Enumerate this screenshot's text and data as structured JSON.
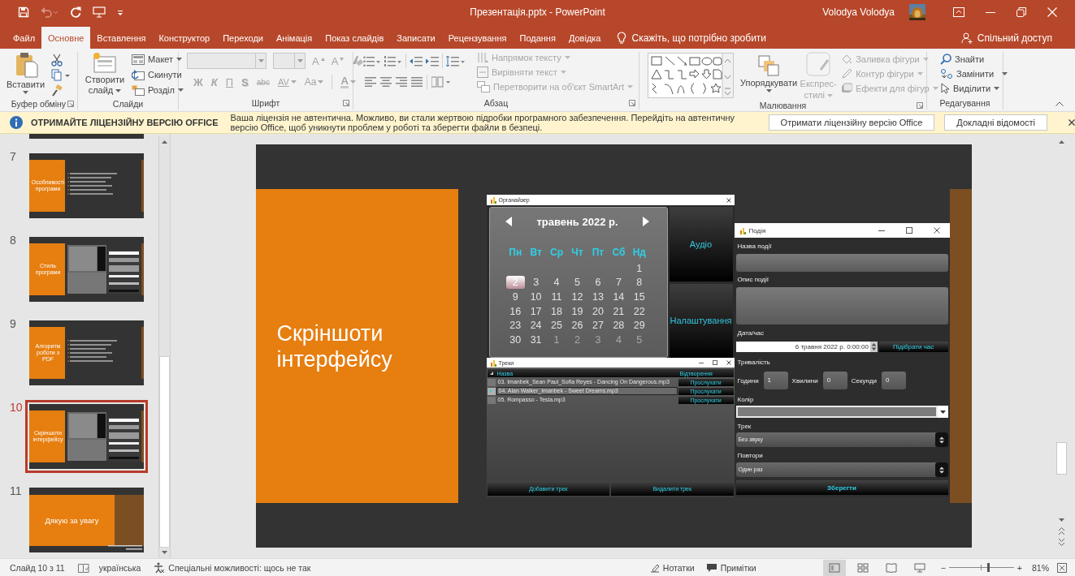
{
  "window": {
    "title": "Презентація.pptx - PowerPoint",
    "user": "Volodya Volodya"
  },
  "ribbon_tabs": [
    {
      "label": "Файл",
      "selected": false
    },
    {
      "label": "Основне",
      "selected": true
    },
    {
      "label": "Вставлення",
      "selected": false
    },
    {
      "label": "Конструктор",
      "selected": false
    },
    {
      "label": "Переходи",
      "selected": false
    },
    {
      "label": "Анімація",
      "selected": false
    },
    {
      "label": "Показ слайдів",
      "selected": false
    },
    {
      "label": "Записати",
      "selected": false
    },
    {
      "label": "Рецензування",
      "selected": false
    },
    {
      "label": "Подання",
      "selected": false
    },
    {
      "label": "Довідка",
      "selected": false
    }
  ],
  "tell_me": "Скажіть, що потрібно зробити",
  "share": "Спільний доступ",
  "ribbon_groups": [
    {
      "kind": "clipboard",
      "label": "Буфер обміну",
      "items": [
        {
          "label": "Вставити",
          "disabled": false
        }
      ]
    },
    {
      "kind": "slides",
      "label": "Слайди",
      "items": [
        {
          "label": "Створити слайд",
          "disabled": false
        },
        {
          "label": "Макет",
          "disabled": false
        },
        {
          "label": "Скинути",
          "disabled": false
        },
        {
          "label": "Розділ",
          "disabled": false
        }
      ]
    },
    {
      "kind": "font",
      "label": "Шрифт",
      "items": [
        {
          "label": "A",
          "disabled": true
        },
        {
          "label": "A",
          "disabled": true
        },
        {
          "label": "Ж",
          "disabled": true
        },
        {
          "label": "К",
          "disabled": true
        },
        {
          "label": "П",
          "disabled": true
        },
        {
          "label": "S",
          "disabled": true
        },
        {
          "label": "abc",
          "disabled": true
        },
        {
          "label": "AV",
          "disabled": true
        },
        {
          "label": "Aa",
          "disabled": true
        },
        {
          "label": "A",
          "disabled": true
        }
      ]
    },
    {
      "kind": "paragraph",
      "label": "Абзац",
      "items": [
        {
          "label": "Напрямок тексту",
          "disabled": true
        },
        {
          "label": "Вирівняти текст",
          "disabled": true
        },
        {
          "label": "Перетворити на об'єкт SmartArt",
          "disabled": true
        }
      ]
    },
    {
      "kind": "drawing",
      "label": "Малювання",
      "items": [
        {
          "label": "Упорядкувати",
          "disabled": false
        },
        {
          "label": "Експрес-стилі",
          "disabled": true
        },
        {
          "label": "Заливка фігури",
          "disabled": true
        },
        {
          "label": "Контур фігури",
          "disabled": true
        },
        {
          "label": "Ефекти для фігур",
          "disabled": true
        }
      ]
    },
    {
      "kind": "editing",
      "label": "Редагування",
      "items": [
        {
          "label": "Знайти",
          "disabled": false
        },
        {
          "label": "Замінити",
          "disabled": false
        },
        {
          "label": "Виділити",
          "disabled": false
        }
      ]
    }
  ],
  "license_bar": {
    "heading": "ОТРИМАЙТЕ ЛІЦЕНЗІЙНУ ВЕРСІЮ OFFICE",
    "message": "Ваша ліцензія не автентична. Можливо, ви стали жертвою підробки програмного забезпечення. Перейдіть на автентичну версію Office, щоб уникнути проблем у роботі та зберегти файли в безпеці.",
    "buttons": [
      "Отримати ліцензійну версію Office",
      "Докладні відомості"
    ]
  },
  "thumbnails": [
    {
      "number": "7",
      "title": "Особливості програми",
      "kind": "bullets",
      "selected": false
    },
    {
      "number": "8",
      "title": "Стиль програми",
      "kind": "screens",
      "selected": false
    },
    {
      "number": "9",
      "title": "Алгоритм роботи з PDF",
      "kind": "bullets",
      "selected": false
    },
    {
      "number": "10",
      "title": "Скріншоти інтерфейсу",
      "kind": "screens",
      "selected": true
    },
    {
      "number": "11",
      "title": "Дякую за увагу",
      "kind": "closing",
      "selected": false
    }
  ],
  "slide": {
    "title": "Скріншоти інтерфейсу",
    "organizer": {
      "title": "Органайзер",
      "month": "травень 2022 р.",
      "weekdays": [
        "Пн",
        "Вт",
        "Ср",
        "Чт",
        "Пт",
        "Сб",
        "Нд"
      ],
      "weeks": [
        [
          {
            "day": "1",
            "outside": false,
            "selected": false
          }
        ],
        [
          {
            "day": "2",
            "outside": false,
            "selected": true
          },
          {
            "day": "3",
            "outside": false,
            "selected": false
          },
          {
            "day": "4",
            "outside": false,
            "selected": false
          },
          {
            "day": "5",
            "outside": false,
            "selected": false
          },
          {
            "day": "6",
            "outside": false,
            "selected": false
          },
          {
            "day": "7",
            "outside": false,
            "selected": false
          },
          {
            "day": "8",
            "outside": false,
            "selected": false
          }
        ],
        [
          {
            "day": "9",
            "outside": false,
            "selected": false
          },
          {
            "day": "10",
            "outside": false,
            "selected": false
          },
          {
            "day": "11",
            "outside": false,
            "selected": false
          },
          {
            "day": "12",
            "outside": false,
            "selected": false
          },
          {
            "day": "13",
            "outside": false,
            "selected": false
          },
          {
            "day": "14",
            "outside": false,
            "selected": false
          },
          {
            "day": "15",
            "outside": false,
            "selected": false
          }
        ],
        [
          {
            "day": "16",
            "outside": false,
            "selected": false
          },
          {
            "day": "17",
            "outside": false,
            "selected": false
          },
          {
            "day": "18",
            "outside": false,
            "selected": false
          },
          {
            "day": "19",
            "outside": false,
            "selected": false
          },
          {
            "day": "20",
            "outside": false,
            "selected": false
          },
          {
            "day": "21",
            "outside": false,
            "selected": false
          },
          {
            "day": "22",
            "outside": false,
            "selected": false
          }
        ],
        [
          {
            "day": "23",
            "outside": false,
            "selected": false
          },
          {
            "day": "24",
            "outside": false,
            "selected": false
          },
          {
            "day": "25",
            "outside": false,
            "selected": false
          },
          {
            "day": "26",
            "outside": false,
            "selected": false
          },
          {
            "day": "27",
            "outside": false,
            "selected": false
          },
          {
            "day": "28",
            "outside": false,
            "selected": false
          },
          {
            "day": "29",
            "outside": false,
            "selected": false
          }
        ],
        [
          {
            "day": "30",
            "outside": false,
            "selected": false
          },
          {
            "day": "31",
            "outside": false,
            "selected": false
          },
          {
            "day": "1",
            "outside": true,
            "selected": false
          },
          {
            "day": "2",
            "outside": true,
            "selected": false
          },
          {
            "day": "3",
            "outside": true,
            "selected": false
          },
          {
            "day": "4",
            "outside": true,
            "selected": false
          },
          {
            "day": "5",
            "outside": true,
            "selected": false
          }
        ]
      ],
      "buttons": [
        "Аудіо",
        "Налаштування"
      ]
    },
    "tracks": {
      "title": "Треки",
      "columns": [
        "Назва",
        "Відтворення"
      ],
      "rows": [
        {
          "name": "03. Imanbek_Sean Paul_Sofia Reyes - Dancing On Dangerous.mp3",
          "action": "Прослухати",
          "selected": false
        },
        {
          "name": "04. Alan Walker_Imanbek - Sweet Dreams.mp3",
          "action": "Прослухати",
          "selected": true
        },
        {
          "name": "05. Rompasso - Tesla.mp3",
          "action": "Прослухати",
          "selected": false
        }
      ],
      "buttons": [
        "Добавити трек",
        "Видалити трек"
      ]
    },
    "event": {
      "title": "Подія",
      "name_label": "Назва події",
      "description_label": "Опис події",
      "datetime_label": "Дата/час",
      "datetime": "6 травня 2022 р. 0:00:00",
      "pick_time": "Підібрати час",
      "duration_label": "Тривалість",
      "duration": [
        {
          "label": "Години",
          "value": "1"
        },
        {
          "label": "Хвилини",
          "value": "0"
        },
        {
          "label": "Секунди",
          "value": "0"
        }
      ],
      "color_label": "Колір",
      "track_label": "Трек",
      "track": "Без звуку",
      "repeat_label": "Повтори",
      "repeat": "Один раз",
      "save": "Зберегти"
    }
  },
  "status_bar": {
    "slide": "Слайд 10 з 11",
    "language": "українська",
    "accessibility": "Спеціальні можливості: щось не так",
    "notes": "Нотатки",
    "comments": "Примітки",
    "views": [
      {
        "selected": true
      },
      {
        "selected": false
      },
      {
        "selected": false
      },
      {
        "selected": false
      }
    ],
    "zoom_out": "−",
    "zoom_in": "+",
    "zoom_slider": {
      "level": 0.6
    },
    "zoom": "81%"
  }
}
